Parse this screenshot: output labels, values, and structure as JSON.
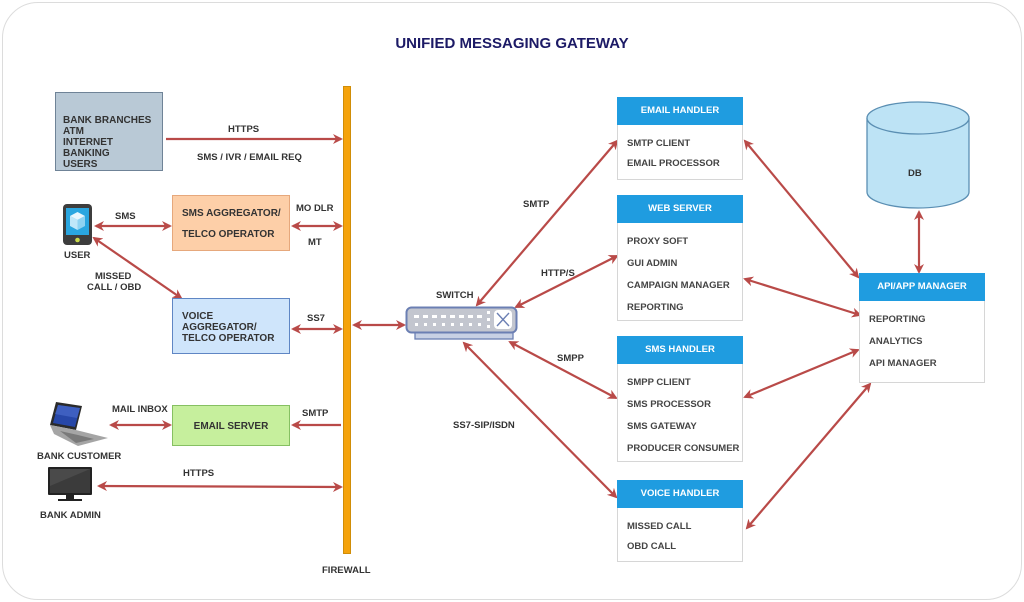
{
  "title": "UNIFIED MESSAGING GATEWAY",
  "colors": {
    "title": "#1c1a66",
    "arrow": "#b94a48",
    "firewall": "#f5a30c",
    "handler_header": "#1f9ce0",
    "bank_box": "#b9c9d6",
    "sms_aggregator": "#fdcfa8",
    "voice_aggregator": "#cfe5fb",
    "email_server": "#c6ef9d",
    "db": "#bde3f5"
  },
  "left": {
    "bank_box": [
      "BANK BRANCHES",
      "ATM",
      "INTERNET BANKING",
      "USERS"
    ],
    "user_label": "USER",
    "user_icon": "mobile-phone-icon",
    "sms_aggregator": [
      "SMS AGGREGATOR/",
      "TELCO OPERATOR"
    ],
    "voice_aggregator": [
      "VOICE AGGREGATOR/",
      "TELCO OPERATOR"
    ],
    "email_server": "EMAIL SERVER",
    "bank_customer_label": "BANK  CUSTOMER",
    "bank_customer_icon": "laptop-icon",
    "bank_admin_label": "BANK ADMIN",
    "bank_admin_icon": "monitor-icon",
    "firewall_label": "FIREWALL"
  },
  "edge_labels": {
    "https_top": "HTTPS",
    "sms_ivr_email": "SMS / IVR / EMAIL REQ",
    "sms": "SMS",
    "mo_dlr": "MO  DLR",
    "mt": "MT",
    "missed_call_1": "MISSED",
    "missed_call_2": "CALL / OBD",
    "ss7": "SS7",
    "mail_inbox": "MAIL INBOX",
    "smtp_left": "SMTP",
    "https_bottom": "HTTPS",
    "switch": "SWITCH",
    "smtp_right": "SMTP",
    "https_right": "HTTP/S",
    "smpp": "SMPP",
    "ss7_sip_isdn": "SS7-SIP/ISDN"
  },
  "handlers": [
    {
      "title": "EMAIL HANDLER",
      "items": [
        "SMTP CLIENT",
        "EMAIL PROCESSOR"
      ]
    },
    {
      "title": "WEB SERVER",
      "items": [
        "PROXY SOFT",
        "GUI ADMIN",
        "CAMPAIGN MANAGER",
        "REPORTING"
      ]
    },
    {
      "title": "SMS HANDLER",
      "items": [
        "SMPP CLIENT",
        "SMS PROCESSOR",
        "SMS GATEWAY",
        "PRODUCER CONSUMER"
      ]
    },
    {
      "title": "VOICE HANDLER",
      "items": [
        "MISSED CALL",
        "OBD CALL"
      ]
    }
  ],
  "db_label": "DB",
  "api_manager": {
    "title": "API/APP MANAGER",
    "items": [
      "REPORTING",
      "ANALYTICS",
      "API MANAGER"
    ]
  },
  "switch_icon": "network-switch-icon"
}
